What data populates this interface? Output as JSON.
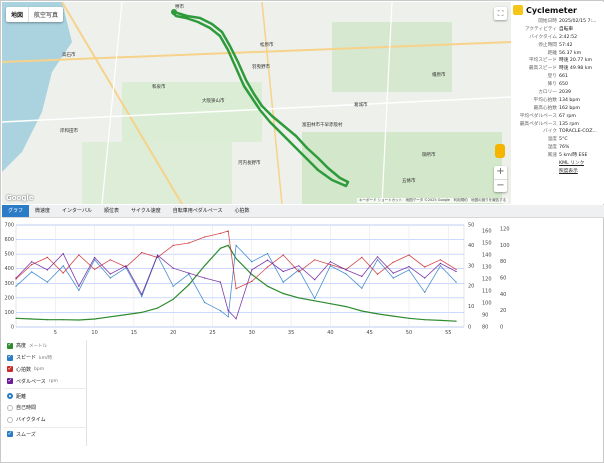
{
  "map": {
    "tabs": [
      "地図",
      "航空写真"
    ],
    "fullscreen_icon": "fullscreen-icon",
    "logo": "Google",
    "footer": "キーボード ショートカット　地図データ ©2025 Google　利用規約　地図の誤りを報告する",
    "places": [
      {
        "name": "堺市",
        "id": "sakai"
      },
      {
        "name": "松原市",
        "id": "matsubara"
      },
      {
        "name": "羽曳野市",
        "id": "habikino"
      },
      {
        "name": "富田林市",
        "id": "tondabayashi"
      },
      {
        "name": "和泉市",
        "id": "izumi"
      },
      {
        "name": "河内長野市",
        "id": "kawachinagano"
      },
      {
        "name": "五條市",
        "id": "gojo"
      },
      {
        "name": "高石市",
        "id": "takaishi"
      },
      {
        "name": "大阪狭山市",
        "id": "osakasayama"
      },
      {
        "name": "葛城市",
        "id": "katsuragi"
      },
      {
        "name": "御所市",
        "id": "gose"
      },
      {
        "name": "千早赤阪村",
        "id": "chihaya"
      },
      {
        "name": "岸和田市",
        "id": "kishiwada"
      },
      {
        "name": "橿原市",
        "id": "kashihara"
      }
    ],
    "accent_route": "#2e9b3b",
    "water": "#aad3df"
  },
  "info": {
    "title": "Cyclemeter",
    "rows": [
      {
        "k": "開始日時",
        "v": "2025/02/15 7:..."
      },
      {
        "k": "アクティビティ",
        "v": "自転車"
      },
      {
        "k": "バイクタイム",
        "v": "2:42:52"
      },
      {
        "k": "停止時間",
        "v": "57:42"
      },
      {
        "k": "距離",
        "v": "56.37 km"
      },
      {
        "k": "平均スピード",
        "v": "時速 20.77 km"
      },
      {
        "k": "最高スピード",
        "v": "時速 49.98 km"
      },
      {
        "k": "登り",
        "v": "661"
      },
      {
        "k": "降り",
        "v": "650"
      },
      {
        "k": "カロリー",
        "v": "2039"
      },
      {
        "k": "平均心拍数",
        "v": "134 bpm"
      },
      {
        "k": "最高心拍数",
        "v": "162 bpm"
      },
      {
        "k": "平均ペダルペース",
        "v": "67 rpm"
      },
      {
        "k": "最高ペダルペース",
        "v": "135 rpm"
      },
      {
        "k": "バイク",
        "v": "TORACLE-COZ..."
      },
      {
        "k": "温度",
        "v": "5°C"
      },
      {
        "k": "湿度",
        "v": "76%"
      },
      {
        "k": "風速",
        "v": "5 km/時 ESE"
      }
    ],
    "link1": "KML リンク",
    "link2": "照度表示"
  },
  "tabs": [
    "グラフ",
    "微速度",
    "インターバル",
    "順位表",
    "サイクル速度",
    "自転車用ペダルペース",
    "心拍数"
  ],
  "controls": {
    "series": [
      {
        "label": "高度",
        "unit": "メートル",
        "color": "#2e8b2e"
      },
      {
        "label": "スピード",
        "unit": "km/時",
        "color": "#2c7bc6"
      },
      {
        "label": "心拍数",
        "unit": "bpm",
        "color": "#cc2a2a"
      },
      {
        "label": "ペダルペース",
        "unit": "rpm",
        "color": "#6a1b9a"
      }
    ],
    "axis_modes": [
      "距離",
      "自己時間",
      "バイクタイム"
    ],
    "selected_axis": "距離",
    "smooth_label": "スムーズ"
  },
  "chart_data": {
    "type": "line",
    "x": [
      0,
      2,
      4,
      6,
      8,
      10,
      12,
      14,
      16,
      18,
      20,
      22,
      24,
      26,
      27,
      28,
      30,
      32,
      34,
      36,
      38,
      40,
      42,
      44,
      46,
      48,
      50,
      52,
      54,
      56
    ],
    "xticks": [
      5,
      10,
      15,
      20,
      25,
      30,
      35,
      40,
      45,
      50,
      55
    ],
    "xlim": [
      0,
      57
    ],
    "y_axes": [
      {
        "ticks": [
          0,
          100,
          200,
          300,
          400,
          500,
          600,
          700
        ],
        "lim": [
          0,
          700
        ]
      },
      {
        "ticks": [
          0,
          10,
          20,
          30,
          40,
          50
        ],
        "lim": [
          0,
          50
        ]
      },
      {
        "ticks": [
          80,
          90,
          100,
          110,
          120,
          130,
          140,
          150,
          160
        ],
        "lim": [
          80,
          165
        ]
      },
      {
        "ticks": [
          0,
          20,
          40,
          60,
          80,
          100,
          120
        ],
        "lim": [
          0,
          125
        ]
      }
    ],
    "series": [
      {
        "name": "高度",
        "axis": 0,
        "values": [
          60,
          55,
          50,
          50,
          48,
          55,
          70,
          85,
          100,
          130,
          190,
          290,
          420,
          540,
          560,
          470,
          360,
          280,
          230,
          200,
          180,
          160,
          140,
          110,
          90,
          75,
          60,
          50,
          45,
          40
        ]
      },
      {
        "name": "スピード",
        "axis": 1,
        "values": [
          20,
          27,
          22,
          30,
          18,
          33,
          24,
          29,
          15,
          35,
          20,
          26,
          12,
          8,
          5,
          40,
          32,
          36,
          22,
          28,
          14,
          30,
          26,
          19,
          33,
          24,
          28,
          17,
          30,
          22
        ]
      },
      {
        "name": "心拍数",
        "axis": 2,
        "values": [
          120,
          132,
          138,
          125,
          140,
          128,
          136,
          130,
          142,
          138,
          148,
          150,
          155,
          158,
          160,
          112,
          118,
          130,
          140,
          126,
          136,
          132,
          128,
          138,
          124,
          134,
          140,
          130,
          136,
          128
        ]
      },
      {
        "name": "ペダルペース",
        "axis": 3,
        "values": [
          60,
          80,
          70,
          90,
          50,
          85,
          65,
          75,
          40,
          88,
          72,
          66,
          60,
          55,
          20,
          10,
          70,
          82,
          68,
          75,
          58,
          80,
          70,
          62,
          86,
          66,
          74,
          60,
          78,
          68
        ]
      }
    ]
  }
}
